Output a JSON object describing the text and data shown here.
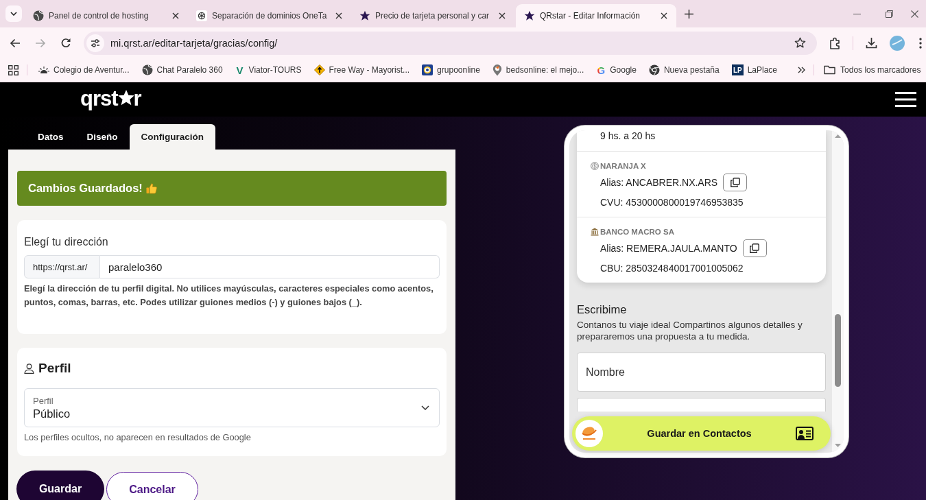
{
  "browser": {
    "tabs": [
      {
        "title": "Panel de control de hosting",
        "selected": false
      },
      {
        "title": "Separación de dominios OneTa",
        "selected": false
      },
      {
        "title": "Precio de tarjeta personal y car",
        "selected": false
      },
      {
        "title": "QRstar - Editar Información",
        "selected": true
      }
    ],
    "address": "mi.qrst.ar/editar-tarjeta/gracias/config/",
    "bookmarks": [
      {
        "label": "Colegio de Aventur..."
      },
      {
        "label": "Chat Paralelo 360"
      },
      {
        "label": "Viator-TOURS",
        "icon_text": "V"
      },
      {
        "label": "Free Way - Mayorist..."
      },
      {
        "label": "grupoonline"
      },
      {
        "label": "bedsonline: el mejo..."
      },
      {
        "label": "Google",
        "icon_text": "G"
      },
      {
        "label": "Nueva pestaña"
      },
      {
        "label": "LaPlace",
        "icon_text": "LP"
      }
    ],
    "all_bookmarks": "Todos los marcadores"
  },
  "header": {
    "logo_start": "qrst",
    "logo_end": "r"
  },
  "editor_tabs": [
    {
      "label": "Datos",
      "selected": false
    },
    {
      "label": "Diseño",
      "selected": false
    },
    {
      "label": "Configuración",
      "selected": true
    }
  ],
  "alert": {
    "text": "Cambios Guardados!"
  },
  "address_card": {
    "label": "Elegí tu dirección",
    "prefix": "https://qrst.ar/",
    "value": "paralelo360",
    "help": "Elegí la dirección de tu perfil digital. No utilices mayúsculas, caracteres especiales como acentos, puntos, comas, barras, etc. Podes utilizar guiones medios (-) y guiones bajos (_)."
  },
  "profile_card": {
    "title": "Perfil",
    "select_label": "Perfil",
    "select_value": "Público",
    "help": "Los perfiles ocultos, no aparecen en resultados de Google"
  },
  "buttons": [
    {
      "label": "Guardar",
      "kind": "primary"
    },
    {
      "label": "Cancelar",
      "kind": "secondary"
    }
  ],
  "preview": {
    "hours": "9 hs. a 20 hs",
    "accounts": [
      {
        "name": "NARANJA X",
        "lines": [
          {
            "text": "Alias: ANCABRER.NX.ARS",
            "copy": true
          },
          {
            "text": "CVU: 4530000800019746953835",
            "copy": false
          }
        ]
      },
      {
        "name": "BANCO MACRO SA",
        "lines": [
          {
            "text": "Alias: REMERA.JAULA.MANTO",
            "copy": true
          },
          {
            "text": "CBU: 2850324840017001005062",
            "copy": false
          }
        ]
      }
    ],
    "contact_form": {
      "title": "Escribime",
      "description": "Contanos tu viaje ideal Compartinos algunos detalles y prepararemos una propuesta a tu medida.",
      "fields": [
        {
          "placeholder": "Nombre",
          "covered": false
        },
        {
          "covered": true
        }
      ]
    },
    "save_contact": "Guardar en Contactos"
  }
}
